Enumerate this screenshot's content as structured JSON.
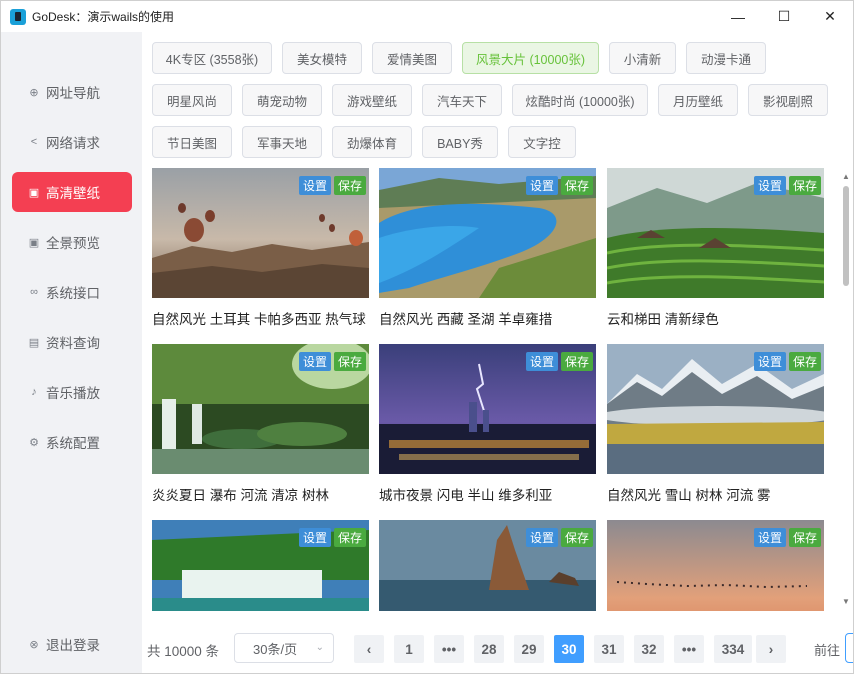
{
  "window": {
    "title": "GoDesk：演示wails的使用",
    "minimize": "—",
    "maximize": "☐",
    "close": "✕"
  },
  "sidebar": {
    "items": [
      {
        "label": "网址导航",
        "icon": "plus-circle-icon",
        "glyph": "⊕"
      },
      {
        "label": "网络请求",
        "icon": "share-icon",
        "glyph": "<"
      },
      {
        "label": "高清壁纸",
        "icon": "image-icon",
        "glyph": "▣",
        "active": true
      },
      {
        "label": "全景预览",
        "icon": "picture-icon",
        "glyph": "▣"
      },
      {
        "label": "系统接口",
        "icon": "link-icon",
        "glyph": "∞"
      },
      {
        "label": "资料查询",
        "icon": "document-icon",
        "glyph": "▤"
      },
      {
        "label": "音乐播放",
        "icon": "microphone-icon",
        "glyph": "♪"
      },
      {
        "label": "系统配置",
        "icon": "gear-icon",
        "glyph": "⚙"
      }
    ],
    "logout": {
      "label": "退出登录",
      "icon": "close-circle-icon",
      "glyph": "⊗"
    }
  },
  "categories": [
    "4K专区 (3558张)",
    "美女模特",
    "爱情美图",
    "风景大片 (10000张)",
    "小清新",
    "动漫卡通",
    "明星风尚",
    "萌宠动物",
    "游戏壁纸",
    "汽车天下",
    "炫酷时尚 (10000张)",
    "月历壁纸",
    "影视剧照",
    "节日美图",
    "军事天地",
    "劲爆体育",
    "BABY秀",
    "文字控"
  ],
  "active_category": "风景大片 (10000张)",
  "card_buttons": {
    "set": "设置",
    "save": "保存"
  },
  "cards": [
    {
      "caption": "自然风光 土耳其 卡帕多西亚 热气球"
    },
    {
      "caption": "自然风光 西藏 圣湖 羊卓雍措"
    },
    {
      "caption": "云和梯田 清新绿色"
    },
    {
      "caption": "炎炎夏日 瀑布 河流 清凉 树林"
    },
    {
      "caption": "城市夜景 闪电 半山 维多利亚"
    },
    {
      "caption": "自然风光 雪山 树林 河流 雾"
    },
    {
      "caption": ""
    },
    {
      "caption": ""
    },
    {
      "caption": ""
    }
  ],
  "pagination": {
    "total": "共 10000 条",
    "page_size": "30条/页",
    "prev": "‹",
    "next": "›",
    "pages": [
      "1",
      "•••",
      "28",
      "29",
      "30",
      "31",
      "32",
      "•••",
      "334"
    ],
    "current": "30",
    "goto_label": "前往"
  },
  "colors": {
    "accent_red": "#f43f52",
    "active_tag_green": "#67c23a",
    "page_active_blue": "#409eff",
    "set_button": "#3e8ed8",
    "save_button": "#4aaa3f"
  }
}
